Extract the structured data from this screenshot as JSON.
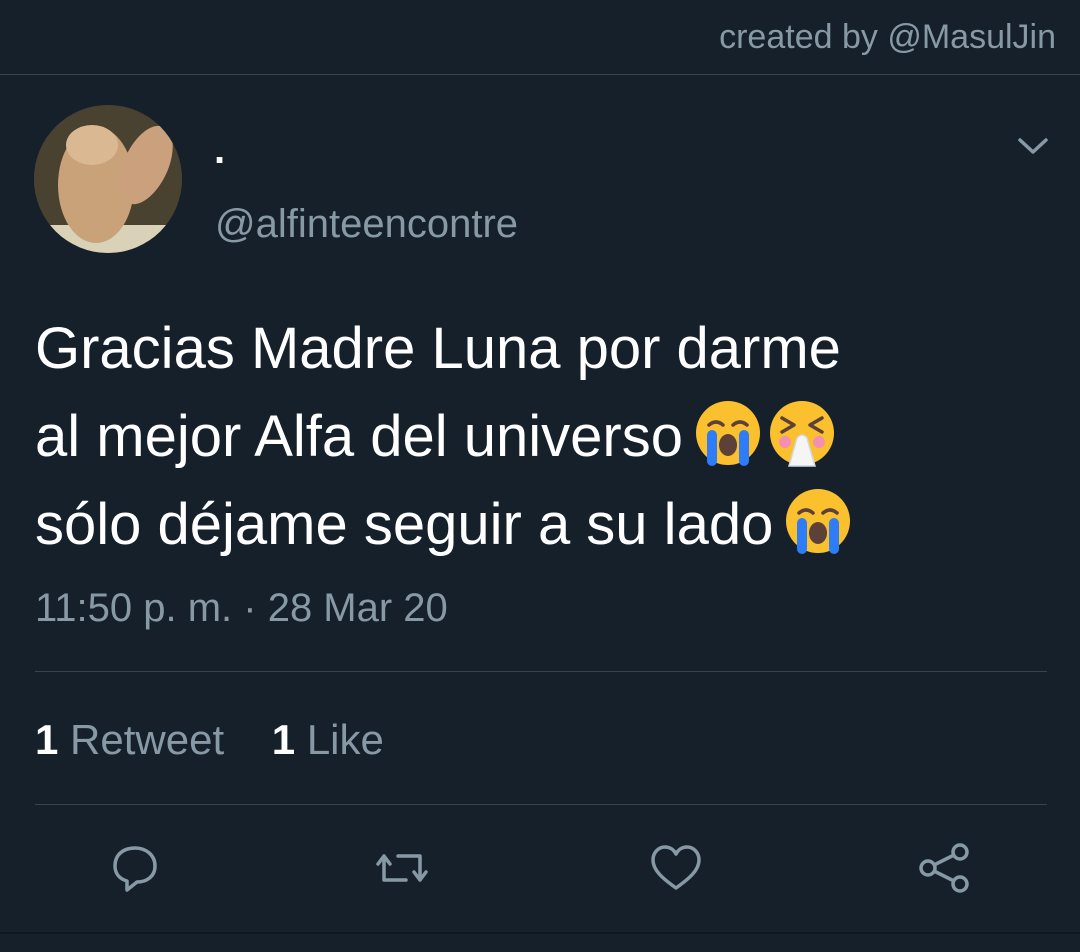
{
  "credit": "created by @MasulJin",
  "tweet": {
    "display_name": ".",
    "handle": "@alfinteencontre",
    "text_lines": [
      "Gracias Madre Luna por darme",
      "al mejor Alfa del universo",
      "sólo déjame seguir a su lado"
    ],
    "emojis_line2": [
      "loudly-crying-face",
      "sneezing-face"
    ],
    "emojis_line3": [
      "loudly-crying-face"
    ],
    "timestamp": "11:50 p. m. · 28 Mar 20",
    "retweets": {
      "count": "1",
      "label": "Retweet"
    },
    "likes": {
      "count": "1",
      "label": "Like"
    }
  },
  "actions": [
    "reply-icon",
    "retweet-icon",
    "like-icon",
    "share-icon"
  ],
  "colors": {
    "background": "#15202b",
    "secondary_text": "#8899a6",
    "divider": "#38444d",
    "primary_text": "#ffffff"
  }
}
